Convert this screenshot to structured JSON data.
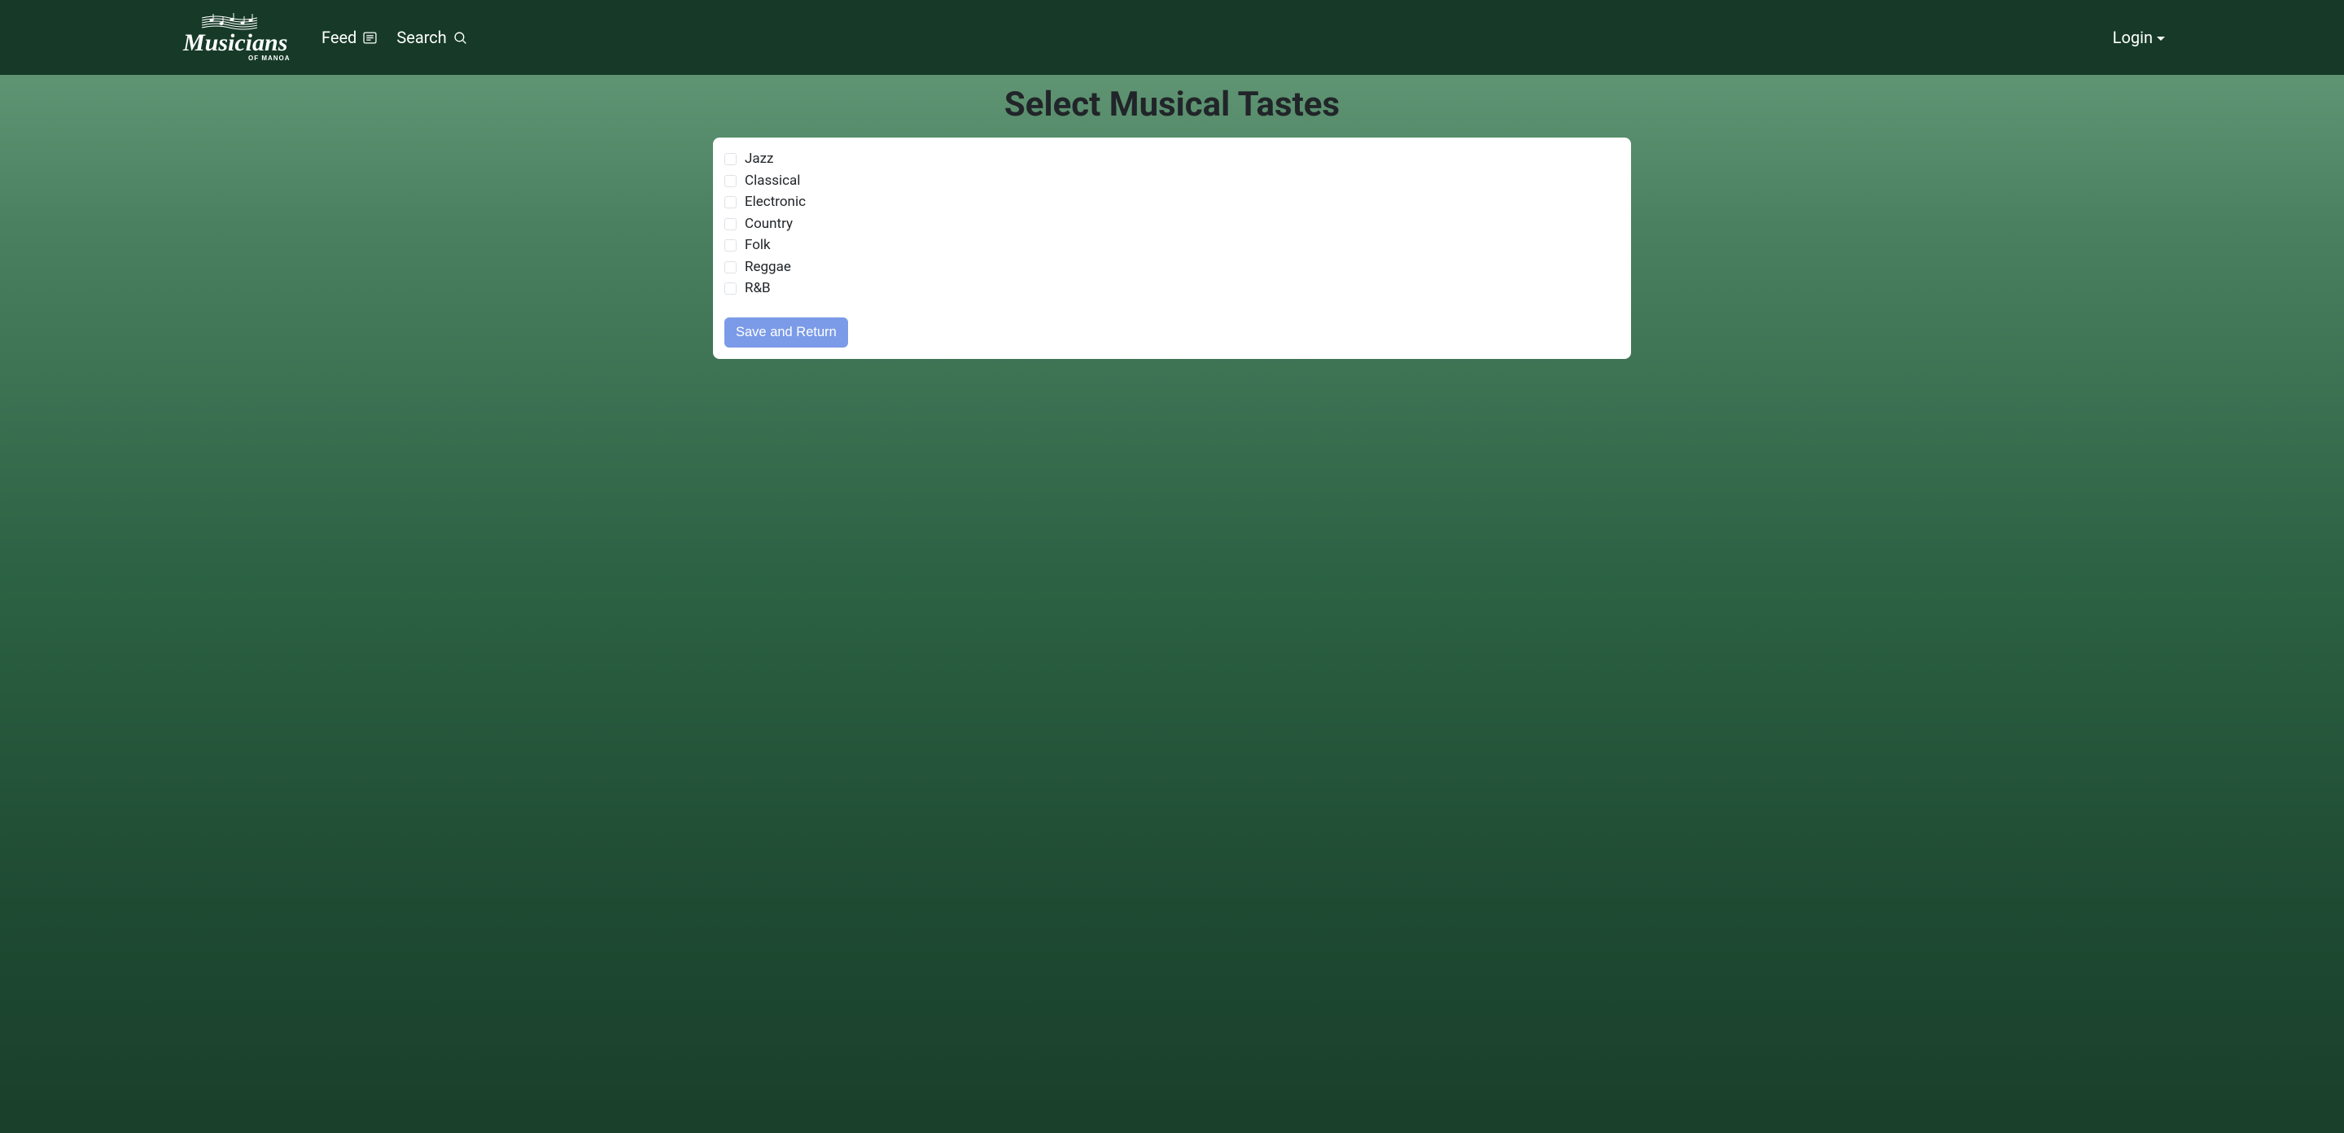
{
  "navbar": {
    "feed_label": "Feed",
    "search_label": "Search",
    "login_label": "Login",
    "logo_main": "Musicians",
    "logo_sub": "OF MANOA"
  },
  "page": {
    "title": "Select Musical Tastes"
  },
  "tastes": [
    {
      "label": "Jazz",
      "checked": false
    },
    {
      "label": "Classical",
      "checked": false
    },
    {
      "label": "Electronic",
      "checked": false
    },
    {
      "label": "Country",
      "checked": false
    },
    {
      "label": "Folk",
      "checked": false
    },
    {
      "label": "Reggae",
      "checked": false
    },
    {
      "label": "R&B",
      "checked": false
    }
  ],
  "buttons": {
    "save_label": "Save and Return"
  }
}
